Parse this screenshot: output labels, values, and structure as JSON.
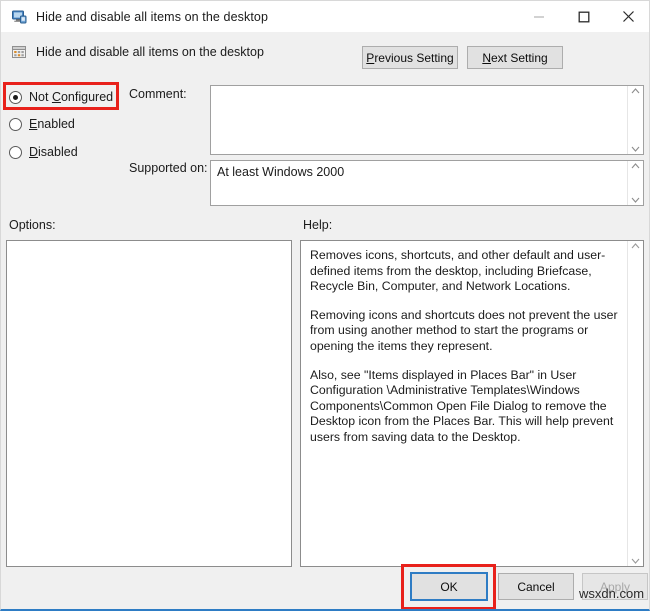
{
  "window": {
    "title": "Hide and disable all items on the desktop",
    "icon": "computer-policy-icon",
    "controls": {
      "minimize": "minimize-icon",
      "maximize": "maximize-icon",
      "close": "close-icon"
    },
    "accent_color": "#2e7cc4",
    "background_color": "#f0f0f0"
  },
  "header": {
    "icon": "policy-setting-icon",
    "title": "Hide and disable all items on the desktop",
    "previous_setting_label": "Previous Setting",
    "previous_setting_accel": "P",
    "next_setting_label": "Next Setting",
    "next_setting_accel": "N"
  },
  "state_options": {
    "selected": "Not Configured",
    "items": [
      {
        "label": "Not Configured",
        "accel": "C",
        "prefix": "Not ",
        "suffix": "onfigured",
        "selected": true
      },
      {
        "label": "Enabled",
        "accel": "E",
        "prefix": "",
        "suffix": "nabled",
        "selected": false
      },
      {
        "label": "Disabled",
        "accel": "D",
        "prefix": "",
        "suffix": "isabled",
        "selected": false
      }
    ]
  },
  "comment": {
    "label": "Comment:",
    "value": "",
    "placeholder": ""
  },
  "supported_on": {
    "label": "Supported on:",
    "value": "At least Windows 2000"
  },
  "options": {
    "label": "Options:",
    "content": ""
  },
  "help": {
    "label": "Help:",
    "paragraphs": [
      "Removes icons, shortcuts, and other default and user-defined items from the desktop, including Briefcase, Recycle Bin, Computer, and Network Locations.",
      "Removing icons and shortcuts does not prevent the user from using another method to start the programs or opening the items they represent.",
      "Also, see \"Items displayed in Places Bar\" in User Configuration \\Administrative Templates\\Windows Components\\Common Open File Dialog to remove the Desktop icon from the Places Bar. This will help prevent users from saving data to the Desktop."
    ]
  },
  "footer": {
    "ok_label": "OK",
    "cancel_label": "Cancel",
    "apply_label": "Apply",
    "apply_enabled": false
  },
  "annotations": {
    "highlight_color": "#e8211b",
    "highlighted_elements": [
      "Not Configured",
      "OK"
    ]
  },
  "watermark": {
    "text": "wsxdn.com"
  }
}
